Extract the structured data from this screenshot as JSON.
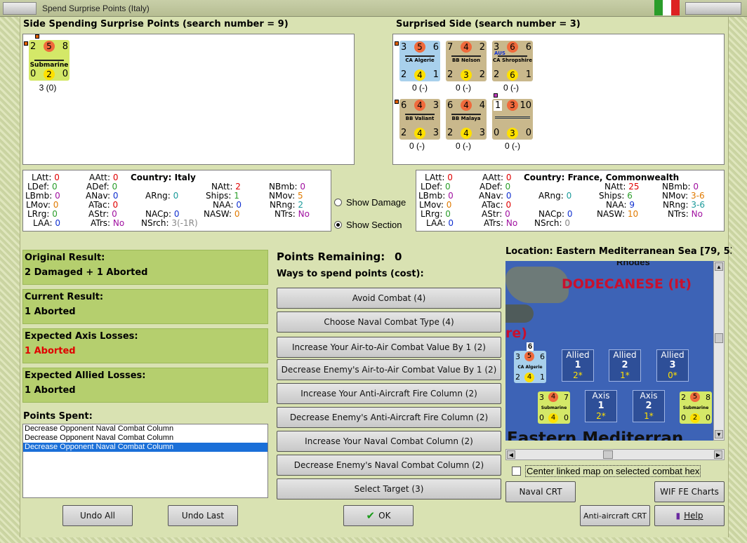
{
  "window": {
    "title": "Spend Surprise Points (Italy)"
  },
  "left_panel": {
    "header": "Side Spending Surprise Points (search number = 9)",
    "counters": [
      {
        "name": "Submarine",
        "tl": "2",
        "tc": "5",
        "tr": "8",
        "bl": "0",
        "bc": "2",
        "br": "0",
        "status": "3 (0)",
        "color": "#d4e868"
      }
    ]
  },
  "right_panel": {
    "header": "Surprised Side (search number = 3)",
    "counters": [
      {
        "name": "CA Algerie",
        "tl": "3",
        "tc": "5",
        "tr": "6",
        "bl": "2",
        "bc": "4",
        "br": "1",
        "status": "0 (-)",
        "color": "#a8d0ec"
      },
      {
        "name": "BB Nelson",
        "tl": "7",
        "tc": "4",
        "tr": "2",
        "bl": "2",
        "bc": "3",
        "br": "2",
        "status": "0 (-)",
        "color": "#c9b88c"
      },
      {
        "name": "CA Shropshire",
        "tl": "3",
        "tc": "6",
        "tr": "6",
        "bl": "2",
        "bc": "6",
        "br": "1",
        "status": "0 (-)",
        "color": "#c9b88c",
        "badge": "AUS"
      },
      {
        "name": "BB Valiant",
        "tl": "6",
        "tc": "4",
        "tr": "3",
        "bl": "2",
        "bc": "4",
        "br": "3",
        "status": "0 (-)",
        "color": "#c9b88c"
      },
      {
        "name": "BB Malaya",
        "tl": "6",
        "tc": "4",
        "tr": "4",
        "bl": "2",
        "bc": "4",
        "br": "3",
        "status": "0 (-)",
        "color": "#c9b88c"
      },
      {
        "name": "",
        "tl": "1",
        "tc": "3",
        "tr": "10",
        "bl": "0",
        "bc": "3",
        "br": "0",
        "status": "0 (-)",
        "color": "#c9b88c"
      }
    ]
  },
  "left_stats": {
    "country_label": "Country:",
    "country": "Italy",
    "LAtt": "0",
    "LDef": "0",
    "LBmb": "0",
    "LMov": "0",
    "LRrg": "0",
    "LAA": "0",
    "AAtt": "0",
    "ADef": "0",
    "ANav": "0",
    "ATac": "0",
    "AStr": "0",
    "ATrs": "No",
    "ARng": "0",
    "NACp": "0",
    "NSrch": "3(-1R)",
    "NAtt": "2",
    "Ships": "1",
    "NAA": "0",
    "NASW": "0",
    "NBmb": "0",
    "NMov": "5",
    "NRng": "2",
    "NTrs": "No"
  },
  "right_stats": {
    "country_label": "Country:",
    "country": "France, Commonwealth",
    "LAtt": "0",
    "LDef": "0",
    "LBmb": "0",
    "LMov": "0",
    "LRrg": "0",
    "LAA": "0",
    "AAtt": "0",
    "ADef": "0",
    "ANav": "0",
    "ATac": "0",
    "AStr": "0",
    "ATrs": "No",
    "ARng": "0",
    "NACp": "0",
    "NSrch": "0",
    "NAtt": "25",
    "Ships": "6",
    "NAA": "9",
    "NASW": "10",
    "NBmb": "0",
    "NMov": "3-6",
    "NRng": "3-6",
    "NTrs": "No"
  },
  "options": {
    "show_damage": "Show Damage",
    "show_section": "Show Section",
    "selected": "show_section"
  },
  "results": {
    "original_label": "Original Result:",
    "original": "2 Damaged + 1 Aborted",
    "current_label": "Current Result:",
    "current": "1 Aborted",
    "axis_label": "Expected Axis Losses:",
    "axis": "1 Aborted",
    "allied_label": "Expected Allied Losses:",
    "allied": "1 Aborted"
  },
  "points": {
    "spent_label": "Points Spent:",
    "spent_items": [
      "Decrease Opponent Naval Combat Column",
      "Decrease Opponent Naval Combat Column",
      "Decrease Opponent Naval Combat Column"
    ],
    "selected_index": 2,
    "remaining_label": "Points Remaining:",
    "remaining": "0",
    "ways_label": "Ways to spend points (cost):"
  },
  "actions": [
    "Avoid Combat (4)",
    "Choose Naval Combat Type (4)",
    "Increase Your Air-to-Air Combat Value By 1 (2)",
    "Decrease Enemy's Air-to-Air Combat Value By 1 (2)",
    "Increase Your Anti-Aircraft Fire Column (2)",
    "Decrease Enemy's Anti-Aircraft Fire Column (2)",
    "Increase Your Naval Combat Column (2)",
    "Decrease Enemy's Naval Combat Column (2)",
    "Select Target (3)"
  ],
  "map": {
    "location": "Location: Eastern Mediterranean Sea [79, 53",
    "region_label": "DODECANESE (It)",
    "island_label": "Rhodes",
    "partial_label": "re)",
    "sea_label": "Eastern Mediterran",
    "stack_count": "6",
    "boxes": [
      {
        "side": "Allied",
        "num": "1",
        "val": "2*"
      },
      {
        "side": "Allied",
        "num": "2",
        "val": "1*"
      },
      {
        "side": "Allied",
        "num": "3",
        "val": "0*"
      },
      {
        "side": "Axis",
        "num": "1",
        "val": "2*"
      },
      {
        "side": "Axis",
        "num": "2",
        "val": "1*"
      }
    ],
    "center_checkbox": "Center linked map on selected combat hex",
    "counter_a": {
      "name": "CA Algerie",
      "tl": "3",
      "tc": "5",
      "tr": "6",
      "bl": "2",
      "bc": "4",
      "br": "1"
    },
    "counter_b": {
      "name": "Submarine",
      "tl": "3",
      "tc": "4",
      "tr": "7",
      "bl": "0",
      "bc": "4",
      "br": "0"
    },
    "counter_c": {
      "name": "Submarine",
      "tl": "2",
      "tc": "5",
      "tr": "8",
      "bl": "0",
      "bc": "2",
      "br": "0"
    }
  },
  "buttons": {
    "undo_all": "Undo All",
    "undo_last": "Undo Last",
    "ok": "OK",
    "naval_crt": "Naval CRT",
    "wif_charts": "WIF FE Charts",
    "aa_crt": "Anti-aircraft CRT",
    "help": "Help"
  },
  "colors": {
    "result_bg": "#b5cf6e",
    "axis_loss": "#e00000",
    "map_sea": "#3d63b6",
    "region_label": "#c8102e"
  }
}
